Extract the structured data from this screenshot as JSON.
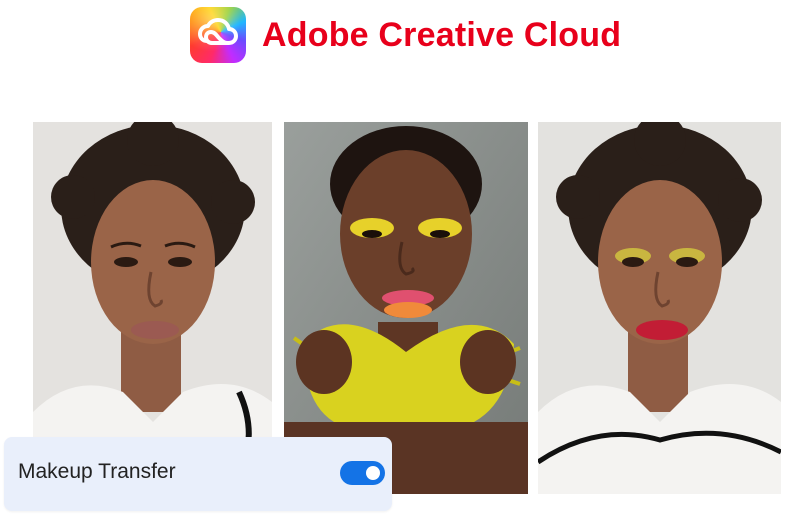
{
  "brand": {
    "title": "Adobe Creative Cloud",
    "logo_icon": "creative-cloud-logo-icon",
    "title_color": "#e8001b"
  },
  "photos": [
    {
      "role": "original-portrait"
    },
    {
      "role": "reference-makeup-portrait"
    },
    {
      "role": "result-portrait"
    }
  ],
  "control": {
    "label": "Makeup Transfer",
    "toggle_on": true,
    "toggle_color": "#1473e6"
  }
}
